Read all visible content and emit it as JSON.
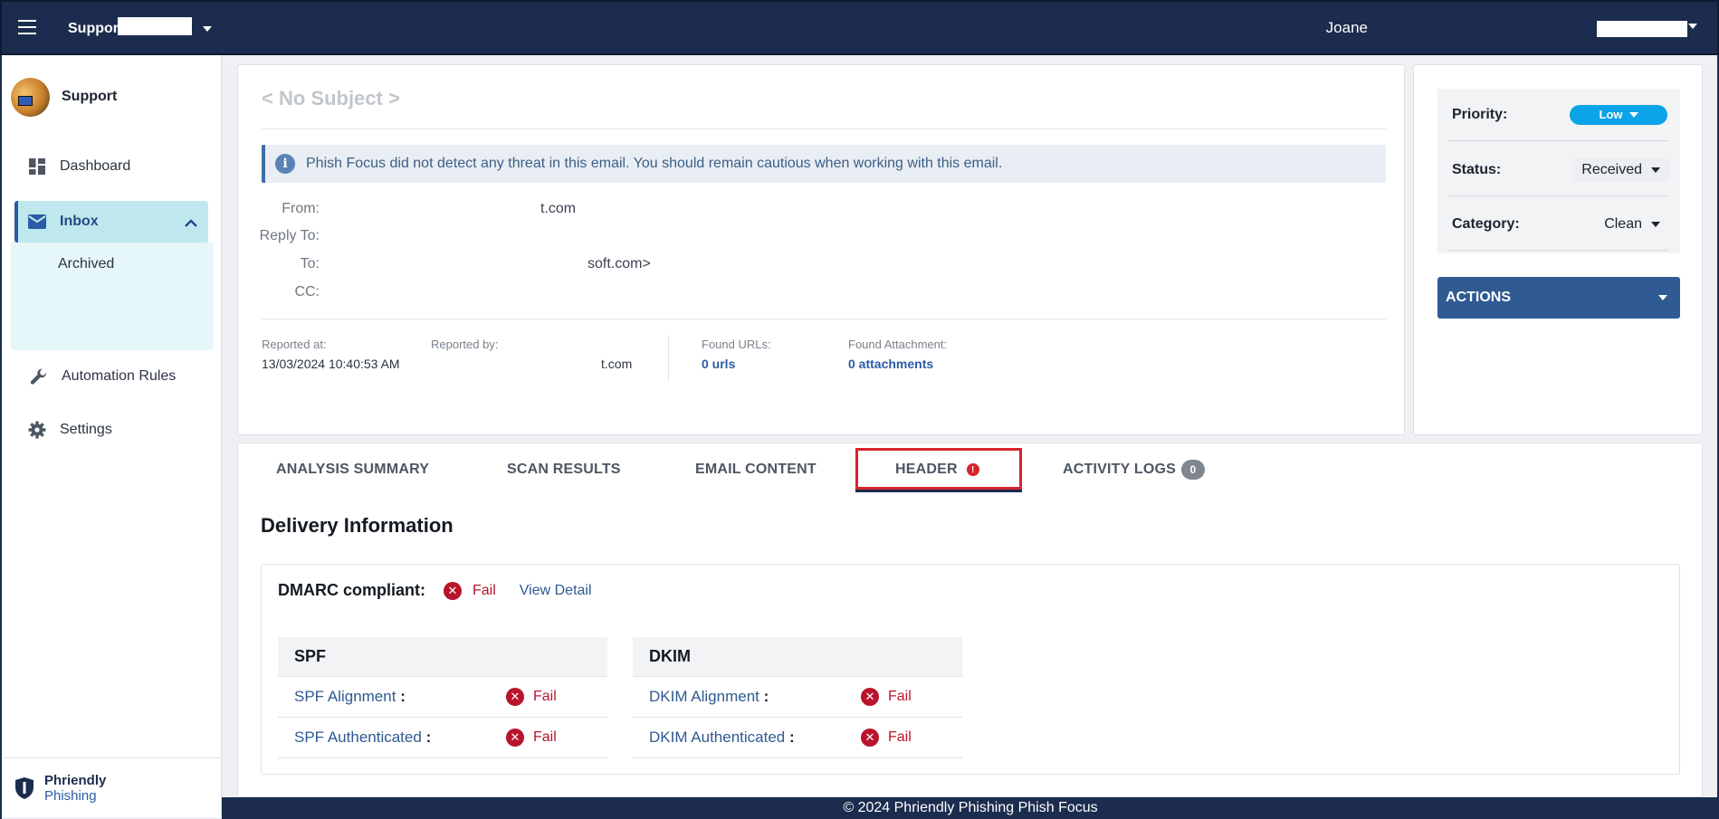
{
  "topbar": {
    "org_name": "Suppor",
    "user_name": "Joane"
  },
  "sidebar": {
    "profile_name": "Support",
    "items": [
      {
        "label": "Dashboard",
        "icon": "dashboard-icon"
      },
      {
        "label": "Inbox",
        "icon": "mail-icon"
      },
      {
        "label": "Archived"
      },
      {
        "label": "Automation Rules",
        "icon": "wrench-icon"
      },
      {
        "label": "Settings",
        "icon": "gear-icon"
      }
    ],
    "brand_line1": "Phriendly",
    "brand_line2": "Phishing"
  },
  "email": {
    "subject": "< No Subject >",
    "alert": "Phish Focus did not detect any threat in this email. You should remain cautious when working with this email.",
    "from_label": "From:",
    "from_value": "t.com",
    "reply_to_label": "Reply To:",
    "to_label": "To:",
    "to_value": "soft.com>",
    "cc_label": "CC:",
    "reported_at_label": "Reported at:",
    "reported_at_value": "13/03/2024 10:40:53 AM",
    "reported_by_label": "Reported by:",
    "reported_by_value": "t.com",
    "found_urls_label": "Found URLs:",
    "found_urls_value": "0 urls",
    "found_attachment_label": "Found Attachment:",
    "found_attachment_value": "0 attachments"
  },
  "properties": {
    "priority_label": "Priority:",
    "priority_value": "Low",
    "status_label": "Status:",
    "status_value": "Received",
    "category_label": "Category:",
    "category_value": "Clean",
    "actions_label": "ACTIONS",
    "priority_color": "#0aa4e8"
  },
  "tabs": [
    {
      "label": "ANALYSIS SUMMARY"
    },
    {
      "label": "SCAN RESULTS"
    },
    {
      "label": "EMAIL CONTENT"
    },
    {
      "label": "HEADER",
      "badge": "!"
    },
    {
      "label": "ACTIVITY LOGS",
      "count": "0"
    }
  ],
  "delivery": {
    "title": "Delivery Information",
    "dmarc_label": "DMARC compliant:",
    "dmarc_result": "Fail",
    "view_detail": "View Detail",
    "spf": {
      "title": "SPF",
      "rows": [
        {
          "name": "SPF Alignment",
          "result": "Fail"
        },
        {
          "name": "SPF Authenticated",
          "result": "Fail"
        }
      ]
    },
    "dkim": {
      "title": "DKIM",
      "rows": [
        {
          "name": "DKIM Alignment",
          "result": "Fail"
        },
        {
          "name": "DKIM Authenticated",
          "result": "Fail"
        }
      ]
    },
    "fail_color": "#b8142c"
  },
  "footer": {
    "text": "© 2024 Phriendly Phishing Phish Focus"
  }
}
